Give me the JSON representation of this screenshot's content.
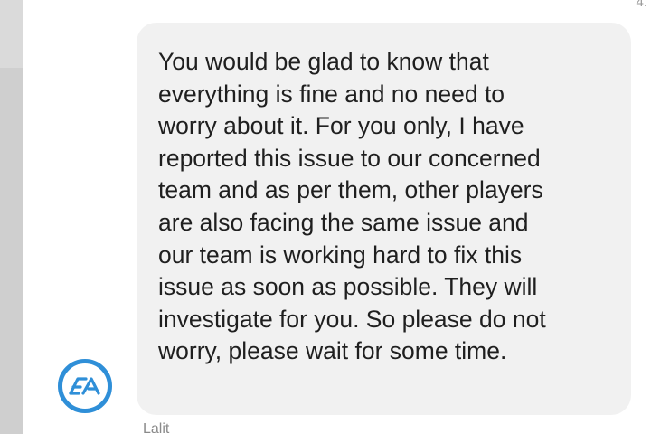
{
  "conversation": {
    "timestamp_fragment": "4.",
    "message": {
      "lines": [
        "You would be glad to know that",
        "everything is fine and no need to",
        "worry about it. For you only, I have",
        "reported this issue to our concerned",
        "team and as per them, other players",
        "are also facing the same issue and",
        "our team is working hard to fix this",
        "issue as soon as possible. They will",
        "investigate for you. So please do not",
        "worry, please wait for some time."
      ]
    },
    "sender": {
      "avatar_icon": "ea-logo-icon",
      "avatar_text": "EA",
      "name": "Lalit",
      "brand_color": "#2f8fd8"
    },
    "bubble_color": "#f1f1f1"
  }
}
